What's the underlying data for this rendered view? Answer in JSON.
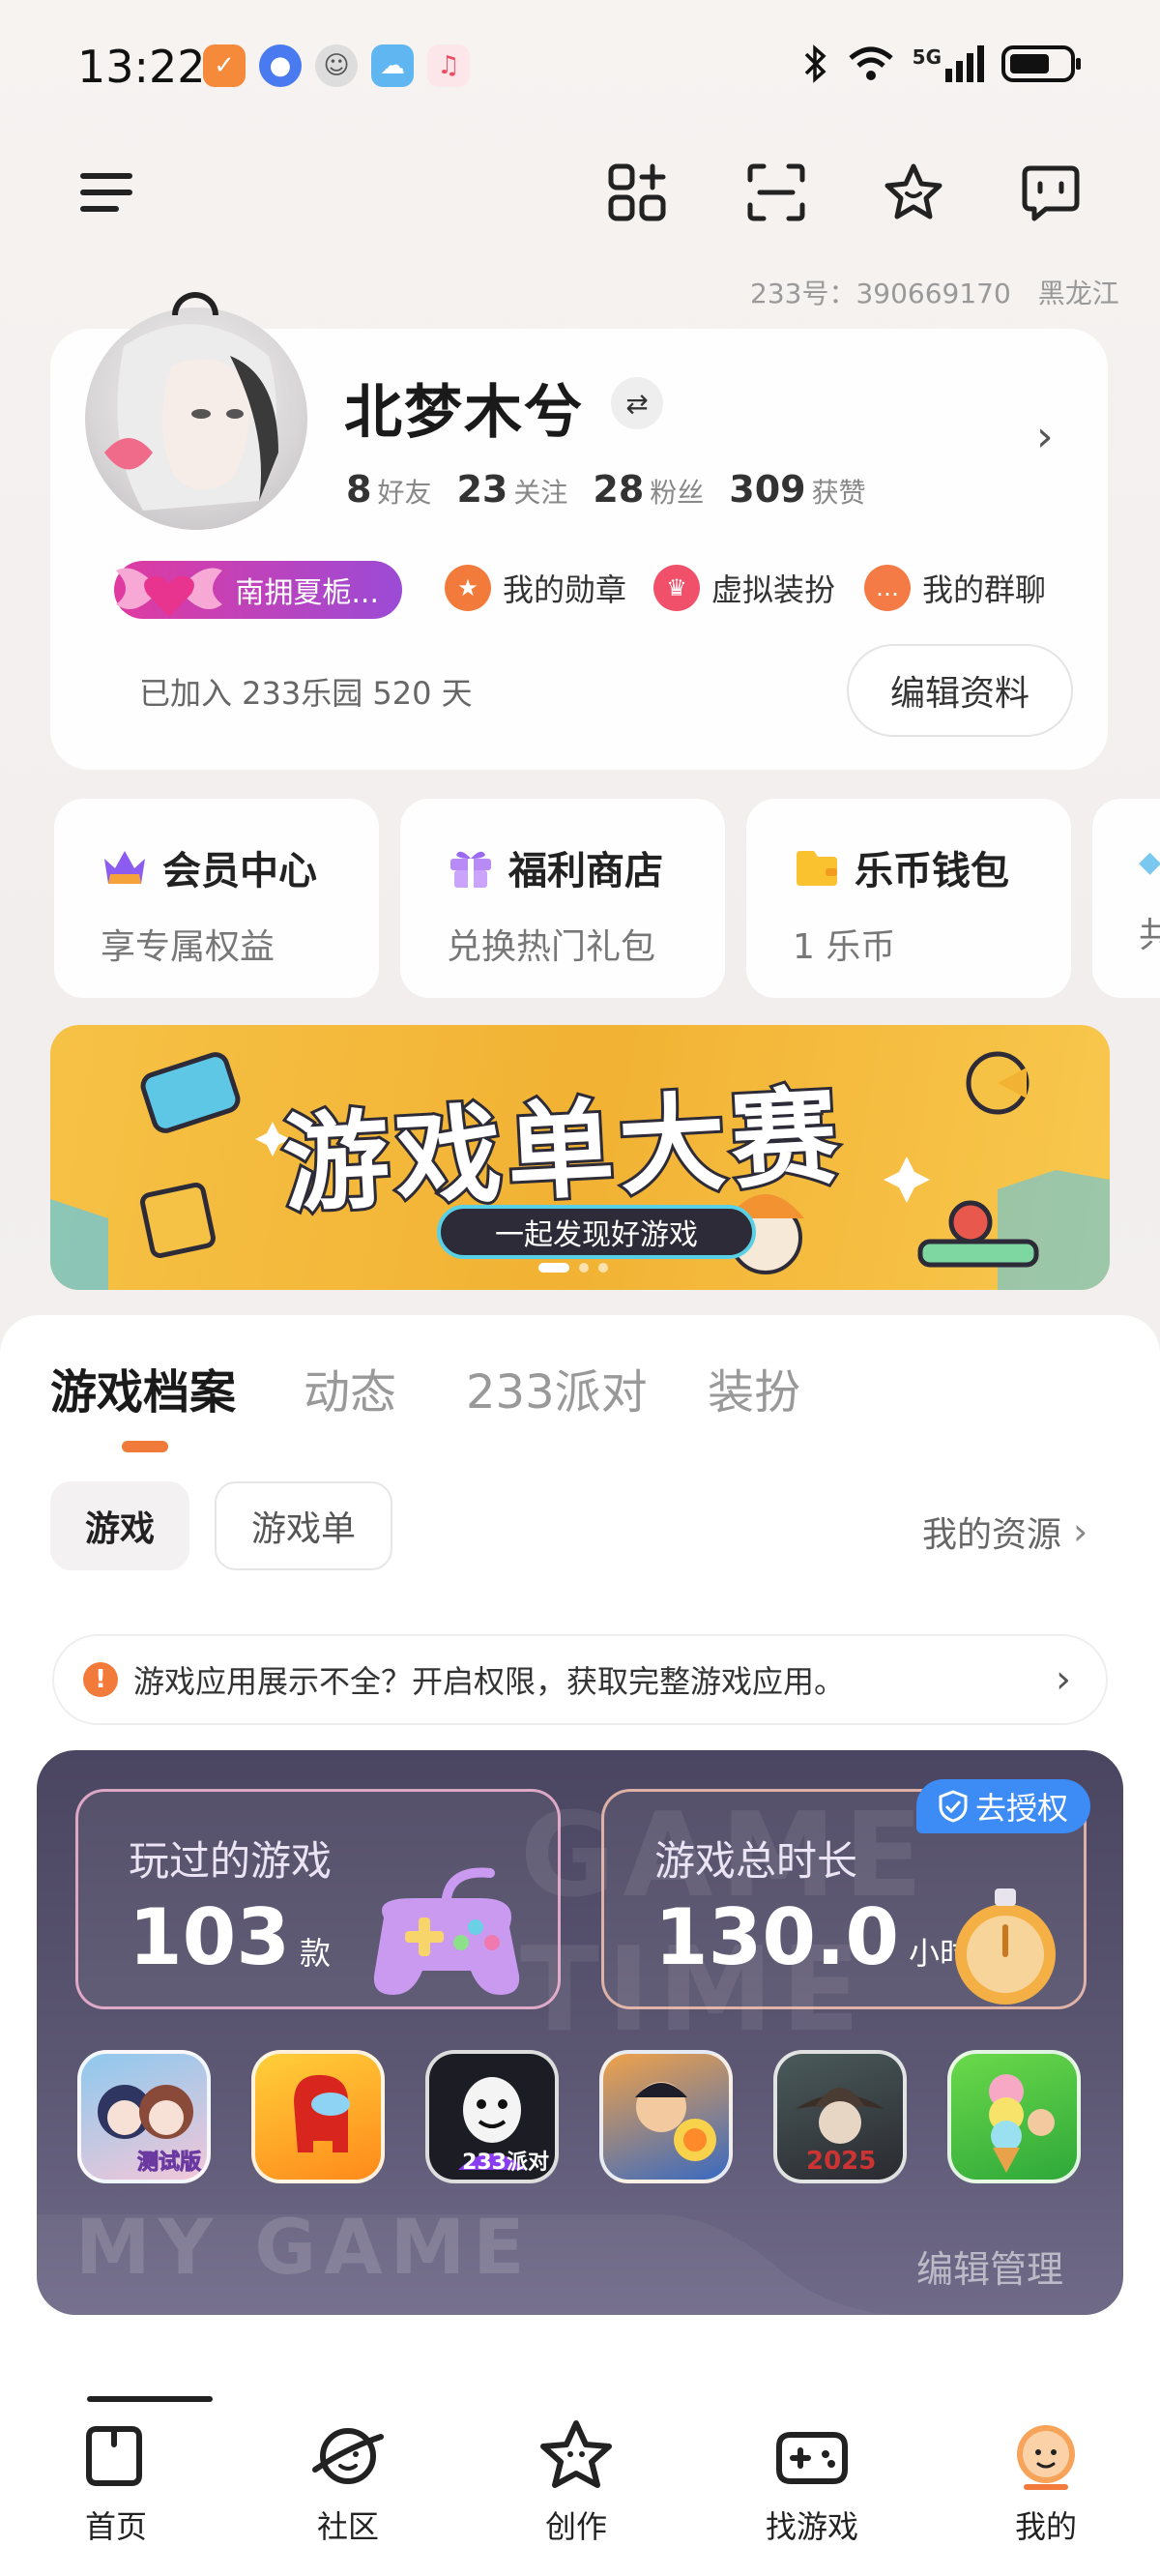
{
  "status_bar": {
    "time": "13:22",
    "network": "5G"
  },
  "header": {
    "account_id": "233号：390669170",
    "region": "黑龙江"
  },
  "profile": {
    "username": "北梦木兮",
    "stats": [
      {
        "value": "8",
        "label": "好友"
      },
      {
        "value": "23",
        "label": "关注"
      },
      {
        "value": "28",
        "label": "粉丝"
      },
      {
        "value": "309",
        "label": "获赞"
      }
    ],
    "badge": "南拥夏栀...",
    "quick_links": [
      {
        "label": "我的勋章",
        "color": "#f27a3b"
      },
      {
        "label": "虚拟装扮",
        "color": "#f0506a"
      },
      {
        "label": "我的群聊",
        "color": "#f47b45"
      }
    ],
    "joined": "已加入 233乐园 520 天",
    "edit_label": "编辑资料"
  },
  "features": [
    {
      "title": "会员中心",
      "subtitle": "享专属权益"
    },
    {
      "title": "福利商店",
      "subtitle": "兑换热门礼包"
    },
    {
      "title": "乐币钱包",
      "subtitle": "1 乐币"
    },
    {
      "title": "",
      "subtitle": "共"
    }
  ],
  "banner": {
    "title": "游戏单大赛",
    "subtitle": "一起发现好游戏"
  },
  "tabs": [
    "游戏档案",
    "动态",
    "233派对",
    "装扮"
  ],
  "chips": [
    "游戏",
    "游戏单"
  ],
  "my_resources": "我的资源",
  "notice": {
    "icon": "!",
    "text": "游戏应用展示不全？开启权限，获取完整游戏应用。"
  },
  "game_stats": {
    "played_label": "玩过的游戏",
    "played_value": "103",
    "played_unit": "款",
    "duration_label": "游戏总时长",
    "duration_value": "130.0",
    "duration_unit": "小时",
    "auth_label": "去授权",
    "icon_labels": [
      "测试版",
      "233派对",
      "2025"
    ],
    "watermark_top": "GAME TIME",
    "watermark_bottom": "MY GAME",
    "edit_manage": "编辑管理"
  },
  "bottom_nav": [
    {
      "label": "首页"
    },
    {
      "label": "社区"
    },
    {
      "label": "创作"
    },
    {
      "label": "找游戏"
    },
    {
      "label": "我的"
    }
  ],
  "colors": {
    "accent": "#ef7a3a",
    "badge_start": "#e03aa0",
    "badge_end": "#9b4bd6",
    "banner": "#f2b233",
    "game_panel": "#4a4560",
    "auth_blue": "#3d8cf5"
  }
}
